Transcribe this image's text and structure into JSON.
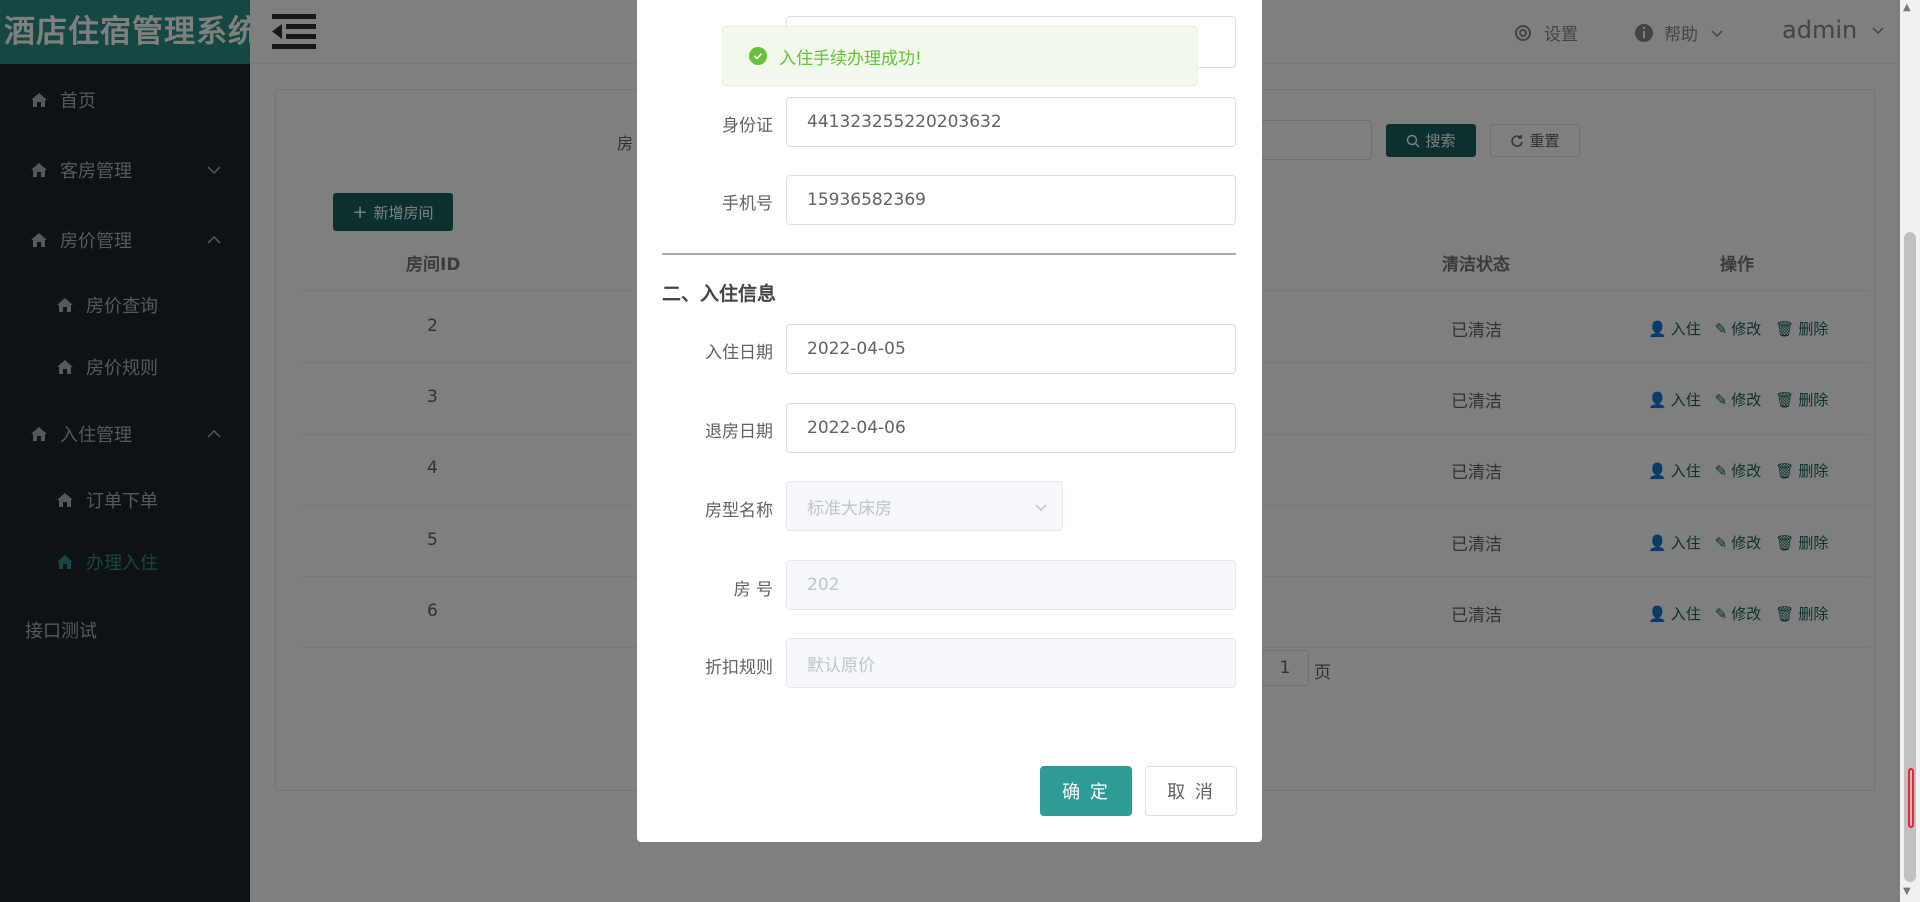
{
  "app": {
    "title": "酒店住宿管理系统"
  },
  "sidebar": {
    "items": [
      {
        "label": "首页"
      },
      {
        "label": "客房管理"
      },
      {
        "label": "房价管理"
      },
      {
        "label": "房价查询"
      },
      {
        "label": "房价规则"
      },
      {
        "label": "入住管理"
      },
      {
        "label": "订单下单"
      },
      {
        "label": "办理入住"
      },
      {
        "label": "接口测试"
      }
    ]
  },
  "header": {
    "settings": "设置",
    "help": "帮助",
    "user": "admin"
  },
  "toolbar": {
    "search_label_fragment": "房",
    "search": "搜索",
    "reset": "重置",
    "add_room": "新增房间"
  },
  "table": {
    "headers": {
      "room_id": "房间ID",
      "clean_status": "清洁状态",
      "actions": "操作"
    },
    "rows": [
      {
        "id": "2",
        "status": "已清洁"
      },
      {
        "id": "3",
        "status": "已清洁"
      },
      {
        "id": "4",
        "status": "已清洁"
      },
      {
        "id": "5",
        "status": "已清洁"
      },
      {
        "id": "6",
        "status": "已清洁"
      }
    ],
    "ops": {
      "checkin": "入住",
      "edit": "修改",
      "delete": "删除"
    }
  },
  "pager": {
    "page": "1",
    "suffix": "页"
  },
  "toast": {
    "message": "入住手续办理成功!"
  },
  "modal": {
    "fields": {
      "id_card_label": "身份证",
      "id_card_value": "441323255220203632",
      "phone_label": "手机号",
      "phone_value": "15936582369",
      "section_title": "二、入住信息",
      "checkin_label": "入住日期",
      "checkin_value": "2022-04-05",
      "checkout_label": "退房日期",
      "checkout_value": "2022-04-06",
      "room_type_label": "房型名称",
      "room_type_value": "标准大床房",
      "room_no_label": "房 号",
      "room_no_value": "202",
      "discount_label": "折扣规则",
      "discount_value": "默认原价"
    },
    "confirm": "确 定",
    "cancel": "取 消"
  },
  "colors": {
    "accent": "#2b8f86",
    "dark_accent": "#17635e",
    "success": "#67c23a",
    "sidebar_bg": "#1d2528"
  }
}
